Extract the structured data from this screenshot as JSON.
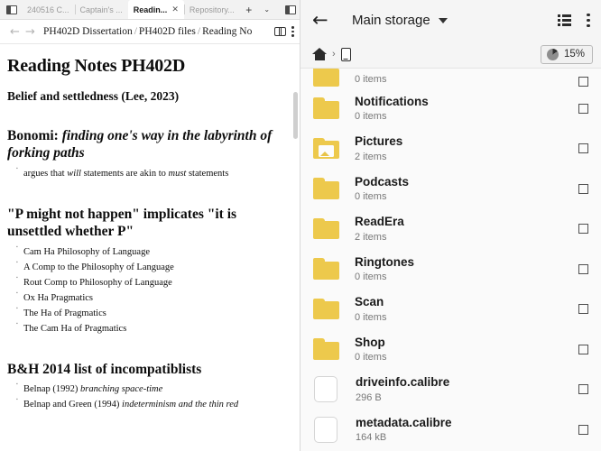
{
  "notes_app": {
    "tabs": [
      {
        "label": "240516 C...",
        "active": false,
        "closable": false
      },
      {
        "label": "Captain's ...",
        "active": false,
        "closable": false
      },
      {
        "label": "Readin...",
        "active": true,
        "closable": true,
        "close_glyph": "✕"
      },
      {
        "label": "Repository...",
        "active": false,
        "closable": false
      }
    ],
    "tab_new_label": "+",
    "tab_chevron_label": "⌄",
    "sidebar_toggle_name": "panel-toggle-icon",
    "tabstrip_right_icon": "panel-right-icon",
    "nav": {
      "back": "←",
      "forward": "→"
    },
    "breadcrumb": {
      "parts": [
        "PH402D Dissertation",
        "PH402D files",
        "Reading No"
      ],
      "separator": "/"
    },
    "document": {
      "title": "Reading Notes PH402D",
      "subtitle": "Belief and settledness (Lee, 2023)",
      "sections": [
        {
          "heading_plain": "Bonomi: ",
          "heading_italic": "finding one's way in the labyrinth of forking paths",
          "items": [
            {
              "pre": "argues that ",
              "em1": "will",
              "mid": " statements are akin to ",
              "em2": "must",
              "post": " statements"
            }
          ]
        },
        {
          "heading_plain": "\"P might not happen\" implicates \"it is unsettled whether P\"",
          "heading_italic": "",
          "items": [
            {
              "pre": "Cam Ha Philosophy of Language",
              "em1": "",
              "mid": "",
              "em2": "",
              "post": ""
            },
            {
              "pre": "A Comp to the Philosophy of Language",
              "em1": "",
              "mid": "",
              "em2": "",
              "post": ""
            },
            {
              "pre": "Rout Comp to Philosophy of Language",
              "em1": "",
              "mid": "",
              "em2": "",
              "post": ""
            },
            {
              "pre": "Ox Ha Pragmatics",
              "em1": "",
              "mid": "",
              "em2": "",
              "post": ""
            },
            {
              "pre": "The Ha of Pragmatics",
              "em1": "",
              "mid": "",
              "em2": "",
              "post": ""
            },
            {
              "pre": "The Cam Ha of Pragmatics",
              "em1": "",
              "mid": "",
              "em2": "",
              "post": ""
            }
          ]
        },
        {
          "heading_plain": "B&H 2014 list of incompatiblists",
          "heading_italic": "",
          "items": [
            {
              "pre": "Belnap (1992) ",
              "em1": "branching space-time",
              "mid": "",
              "em2": "",
              "post": ""
            },
            {
              "pre": "Belnap and Green (1994) ",
              "em1": "indeterminism and the thin red",
              "mid": "",
              "em2": "",
              "post": ""
            }
          ]
        }
      ]
    }
  },
  "file_manager": {
    "back_glyph": "←",
    "title": "Main storage",
    "view_icon": "list-view-icon",
    "overflow_icon": "overflow-menu-icon",
    "path": {
      "home_icon": "home-icon",
      "separator": "›",
      "device_icon": "device-icon"
    },
    "storage": {
      "percent": "15%",
      "used_fraction": 0.15
    },
    "rows": [
      {
        "type": "folder",
        "name": "",
        "sub": "0 items",
        "partial": true,
        "thumb": false
      },
      {
        "type": "folder",
        "name": "Notifications",
        "sub": "0 items",
        "partial": false,
        "thumb": false
      },
      {
        "type": "folder",
        "name": "Pictures",
        "sub": "2 items",
        "partial": false,
        "thumb": true
      },
      {
        "type": "folder",
        "name": "Podcasts",
        "sub": "0 items",
        "partial": false,
        "thumb": false
      },
      {
        "type": "folder",
        "name": "ReadEra",
        "sub": "2 items",
        "partial": false,
        "thumb": false
      },
      {
        "type": "folder",
        "name": "Ringtones",
        "sub": "0 items",
        "partial": false,
        "thumb": false
      },
      {
        "type": "folder",
        "name": "Scan",
        "sub": "0 items",
        "partial": false,
        "thumb": false
      },
      {
        "type": "folder",
        "name": "Shop",
        "sub": "0 items",
        "partial": false,
        "thumb": false
      },
      {
        "type": "file",
        "name": "driveinfo.calibre",
        "sub": "296 B",
        "partial": false,
        "thumb": false
      },
      {
        "type": "file",
        "name": "metadata.calibre",
        "sub": "164 kB",
        "partial": false,
        "thumb": false
      }
    ]
  },
  "colors": {
    "folder_yellow": "#edc94c",
    "appbar_bg": "#f5f5f5",
    "list_bg": "#fafafa",
    "text_primary": "#1a1a1a",
    "text_secondary": "#777777"
  }
}
